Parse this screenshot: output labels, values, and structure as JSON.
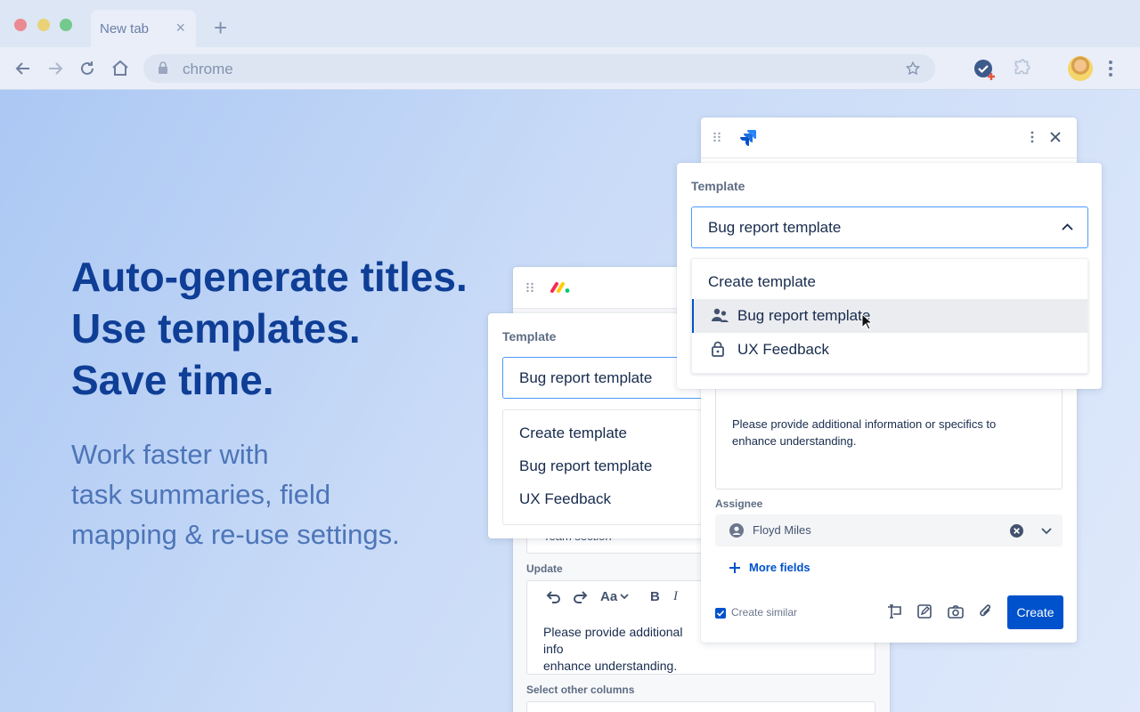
{
  "browser": {
    "tab_title": "New tab",
    "address": "chrome"
  },
  "hero": {
    "headline": [
      "Auto-generate titles.",
      "Use templates.",
      "Save time."
    ],
    "subtitle": [
      "Work faster with",
      "task summaries, field",
      "mapping & re-use settings."
    ]
  },
  "monday_panel": {
    "template_label": "Template",
    "selected_template": "Bug report template",
    "options": [
      "Create template",
      "Bug report template",
      "UX Feedback"
    ],
    "field_peek": "Team section",
    "update_label": "Update",
    "editor_text": "Please provide additional information or specifics to enhance understanding.",
    "editor_text_visible": "Please provide additional info",
    "editor_text_line2": "enhance understanding.",
    "other_columns_label": "Select other columns",
    "font_control": "Aa"
  },
  "jira_panel": {
    "template_label": "Template",
    "selected_template": "Bug report template",
    "options": [
      {
        "label": "Create template",
        "icon": "none"
      },
      {
        "label": "Bug report template",
        "icon": "people-icon",
        "selected": true
      },
      {
        "label": "UX Feedback",
        "icon": "lock-icon"
      }
    ],
    "editor_text": "Please provide additional information or specifics to enhance understanding.",
    "assignee_label": "Assignee",
    "assignee_name": "Floyd Miles",
    "more_fields": "More fields",
    "create_similar": "Create similar",
    "create_similar_checked": true,
    "create_button": "Create"
  },
  "colors": {
    "accent": "#0052cc",
    "headline": "#0f3e96",
    "subtitle": "#4d75b8"
  }
}
